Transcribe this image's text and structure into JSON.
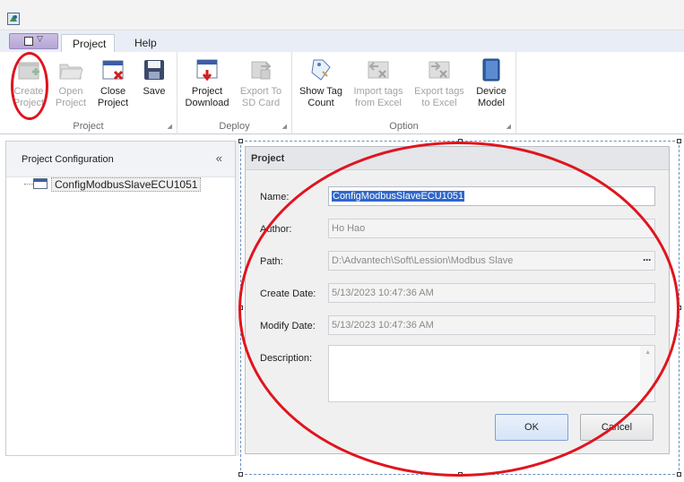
{
  "ribbon": {
    "tabs": {
      "project": "Project",
      "help": "Help"
    },
    "groups": [
      {
        "label": "Project",
        "buttons": [
          {
            "line1": "Create",
            "line2": "Project",
            "enabled": false
          },
          {
            "line1": "Open",
            "line2": "Project",
            "enabled": false
          },
          {
            "line1": "Close",
            "line2": "Project",
            "enabled": true
          },
          {
            "line1": "Save",
            "line2": "",
            "enabled": true
          }
        ]
      },
      {
        "label": "Deploy",
        "buttons": [
          {
            "line1": "Project",
            "line2": "Download",
            "enabled": true
          },
          {
            "line1": "Export To",
            "line2": "SD Card",
            "enabled": false
          }
        ]
      },
      {
        "label": "Option",
        "buttons": [
          {
            "line1": "Show Tag",
            "line2": "Count",
            "enabled": true
          },
          {
            "line1": "Import tags",
            "line2": "from Excel",
            "enabled": false
          },
          {
            "line1": "Export tags",
            "line2": "to Excel",
            "enabled": false
          },
          {
            "line1": "Device",
            "line2": "Model",
            "enabled": true
          }
        ]
      }
    ]
  },
  "left_panel": {
    "title": "Project Configuration",
    "collapse_icon": "double-chevron-left-icon",
    "tree_item": "ConfigModbusSlaveECU1051"
  },
  "dialog": {
    "title": "Project",
    "labels": {
      "name": "Name:",
      "author": "Author:",
      "path": "Path:",
      "create_date": "Create Date:",
      "modify_date": "Modify Date:",
      "description": "Description:"
    },
    "values": {
      "name": "ConfigModbusSlaveECU1051",
      "author": "Ho Hao",
      "path": "D:\\Advantech\\Soft\\Lession\\Modbus Slave",
      "create_date": "5/13/2023 10:47:36 AM",
      "modify_date": "5/13/2023 10:47:36 AM",
      "description": ""
    },
    "path_browse": "···",
    "ok": "OK",
    "cancel": "Cancel"
  },
  "colors": {
    "annotation_red": "#e0141e",
    "selection_blue": "#2f67c9",
    "ribbon_tab_bg": "#e9eef6"
  }
}
